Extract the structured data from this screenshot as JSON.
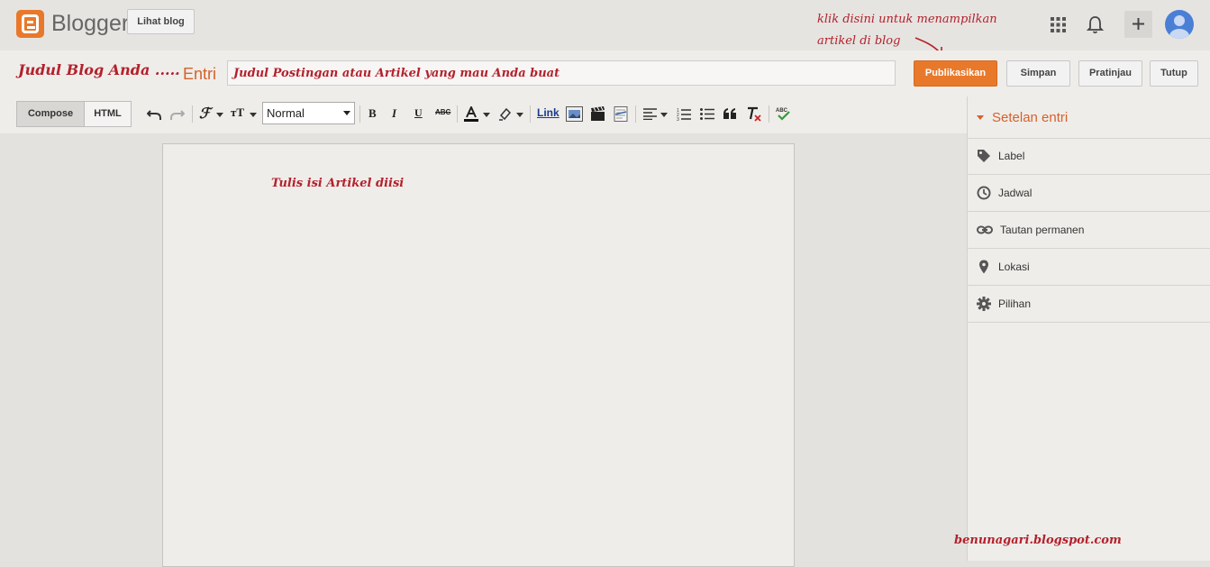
{
  "app": {
    "logo_text": "Blogger",
    "view_blog_label": "Lihat blog"
  },
  "annotations": {
    "publish_hint_line1": "klik disini untuk menampilkan",
    "publish_hint_line2": "artikel di blog",
    "body_hint": "Tulis isi Artikel diisi",
    "watermark": "benunagari.blogspot.com"
  },
  "header_icons": [
    "apps-grid-icon",
    "bell-icon",
    "plus-icon",
    "account-avatar"
  ],
  "post": {
    "blog_name": "Judul Blog Anda .....",
    "separator": "·",
    "entry_label": "Entri",
    "title_value": "Judul Postingan atau Artikel yang mau Anda buat"
  },
  "actions": {
    "publish": "Publikasikan",
    "save": "Simpan",
    "preview": "Pratinjau",
    "close": "Tutup"
  },
  "colors": {
    "accent": "#e8792b",
    "annotation": "#b3212c",
    "sidebar_heading": "#d4622a"
  },
  "toolbar": {
    "compose": "Compose",
    "html": "HTML",
    "format_selected": "Normal",
    "bold": "B",
    "italic": "I",
    "underline": "U",
    "strike": "ABC",
    "link": "Link",
    "font_glyph": "ℱ",
    "size_glyph": "тT"
  },
  "sidebar": {
    "heading": "Setelan entri",
    "items": [
      {
        "label": "Label",
        "icon": "tag-icon"
      },
      {
        "label": "Jadwal",
        "icon": "clock-icon"
      },
      {
        "label": "Tautan permanen",
        "icon": "link-icon"
      },
      {
        "label": "Lokasi",
        "icon": "location-pin-icon"
      },
      {
        "label": "Pilihan",
        "icon": "gear-icon"
      }
    ]
  }
}
